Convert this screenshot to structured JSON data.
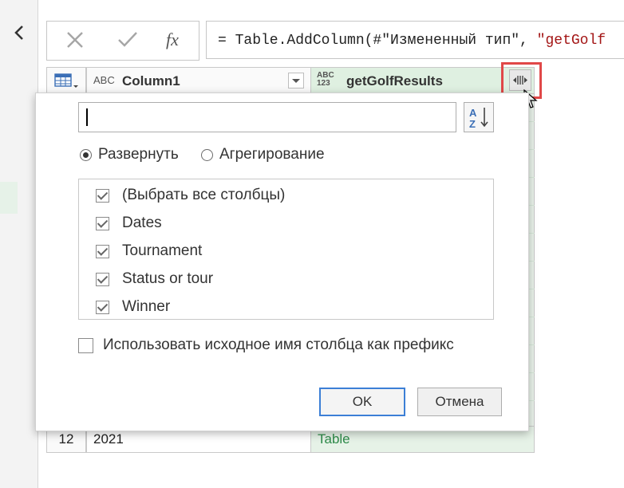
{
  "formula_bar": {
    "cancel_icon": "x-icon",
    "commit_icon": "check-icon",
    "fx_label": "fx",
    "formula_prefix": "= Table.AddColumn(#\"Измененный тип\", ",
    "formula_string": "\"getGolf"
  },
  "grid": {
    "corner_icon": "table-icon",
    "col1": {
      "type_label": "ABC",
      "name": "Column1"
    },
    "col2": {
      "type_label_top": "ABC",
      "type_label_bottom": "123",
      "name": "getGolfResults"
    },
    "row": {
      "index": "12",
      "value": "2021",
      "table_value": "Table"
    }
  },
  "popup": {
    "search": {
      "value": "",
      "placeholder": ""
    },
    "radio_expand": "Развернуть",
    "radio_aggregate": "Агрегирование",
    "items": [
      {
        "label": "(Выбрать все столбцы)",
        "checked": true
      },
      {
        "label": "Dates",
        "checked": true
      },
      {
        "label": "Tournament",
        "checked": true
      },
      {
        "label": "Status or tour",
        "checked": true
      },
      {
        "label": "Winner",
        "checked": true
      }
    ],
    "prefix_label": "Использовать исходное имя столбца как префикс",
    "ok_label": "OK",
    "cancel_label": "Отмена"
  },
  "colors": {
    "highlight": "#e04848",
    "column_green": "#eaf4eb",
    "table_text": "#2e8b4a",
    "ok_border": "#3c7fd6"
  }
}
